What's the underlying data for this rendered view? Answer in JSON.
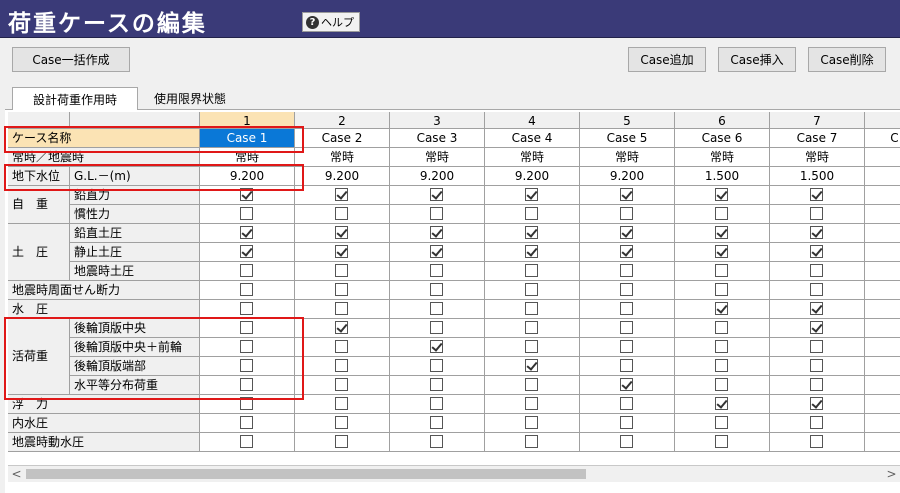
{
  "window": {
    "title": "荷重ケースの編集",
    "help_label": "ヘルプ",
    "help_glyph": "?"
  },
  "toolbar": {
    "bulk_create": "Case一括作成",
    "add": "Case追加",
    "insert": "Case挿入",
    "delete": "Case削除"
  },
  "tabs": [
    {
      "label": "設計荷重作用時",
      "active": true
    },
    {
      "label": "使用限界状態",
      "active": false
    }
  ],
  "grid": {
    "columns": [
      "1",
      "2",
      "3",
      "4",
      "5",
      "6",
      "7"
    ],
    "next_column_partial": "C",
    "case_name": {
      "label": "ケース名称",
      "values": [
        "Case 1",
        "Case 2",
        "Case 3",
        "Case 4",
        "Case 5",
        "Case 6",
        "Case 7"
      ]
    },
    "condition": {
      "label": "常時／地震時",
      "values": [
        "常時",
        "常時",
        "常時",
        "常時",
        "常時",
        "常時",
        "常時"
      ]
    },
    "groundwater": {
      "label": "地下水位",
      "sub_label": "G.L.－(m)",
      "values": [
        "9.200",
        "9.200",
        "9.200",
        "9.200",
        "9.200",
        "1.500",
        "1.500"
      ]
    },
    "groups": {
      "self_weight": "自　重",
      "earth_pressure": "土　圧",
      "live_load": "活荷重"
    },
    "check_rows": [
      {
        "group": "self_weight",
        "label": "鉛直力",
        "values": [
          true,
          true,
          true,
          true,
          true,
          true,
          true
        ]
      },
      {
        "group": "self_weight",
        "label": "慣性力",
        "values": [
          false,
          false,
          false,
          false,
          false,
          false,
          false
        ]
      },
      {
        "group": "earth_pressure",
        "label": "鉛直土圧",
        "values": [
          true,
          true,
          true,
          true,
          true,
          true,
          true
        ]
      },
      {
        "group": "earth_pressure",
        "label": "静止土圧",
        "values": [
          true,
          true,
          true,
          true,
          true,
          true,
          true
        ]
      },
      {
        "group": "earth_pressure",
        "label": "地震時土圧",
        "values": [
          false,
          false,
          false,
          false,
          false,
          false,
          false
        ]
      },
      {
        "group": null,
        "label": "地震時周面せん断力",
        "values": [
          false,
          false,
          false,
          false,
          false,
          false,
          false
        ]
      },
      {
        "group": null,
        "label": "水　圧",
        "values": [
          false,
          false,
          false,
          false,
          false,
          true,
          true
        ]
      },
      {
        "group": "live_load",
        "label": "後輪頂版中央",
        "values": [
          false,
          true,
          false,
          false,
          false,
          false,
          true
        ]
      },
      {
        "group": "live_load",
        "label": "後輪頂版中央＋前輪",
        "values": [
          false,
          false,
          true,
          false,
          false,
          false,
          false
        ]
      },
      {
        "group": "live_load",
        "label": "後輪頂版端部",
        "values": [
          false,
          false,
          false,
          true,
          false,
          false,
          false
        ]
      },
      {
        "group": "live_load",
        "label": "水平等分布荷重",
        "values": [
          false,
          false,
          false,
          false,
          true,
          false,
          false
        ]
      },
      {
        "group": null,
        "label": "浮　力",
        "values": [
          false,
          false,
          false,
          false,
          false,
          true,
          true
        ]
      },
      {
        "group": null,
        "label": "内水圧",
        "values": [
          false,
          false,
          false,
          false,
          false,
          false,
          false
        ]
      },
      {
        "group": null,
        "label": "地震時動水圧",
        "values": [
          false,
          false,
          false,
          false,
          false,
          false,
          false
        ]
      }
    ]
  },
  "scrollbar": {
    "left_arrow": "<",
    "right_arrow": ">"
  },
  "colors": {
    "title_bar": "#3a3a78",
    "selected_header": "#fbe3b4",
    "selected_cell": "#0a78d7",
    "highlight_box": "#e01818"
  }
}
